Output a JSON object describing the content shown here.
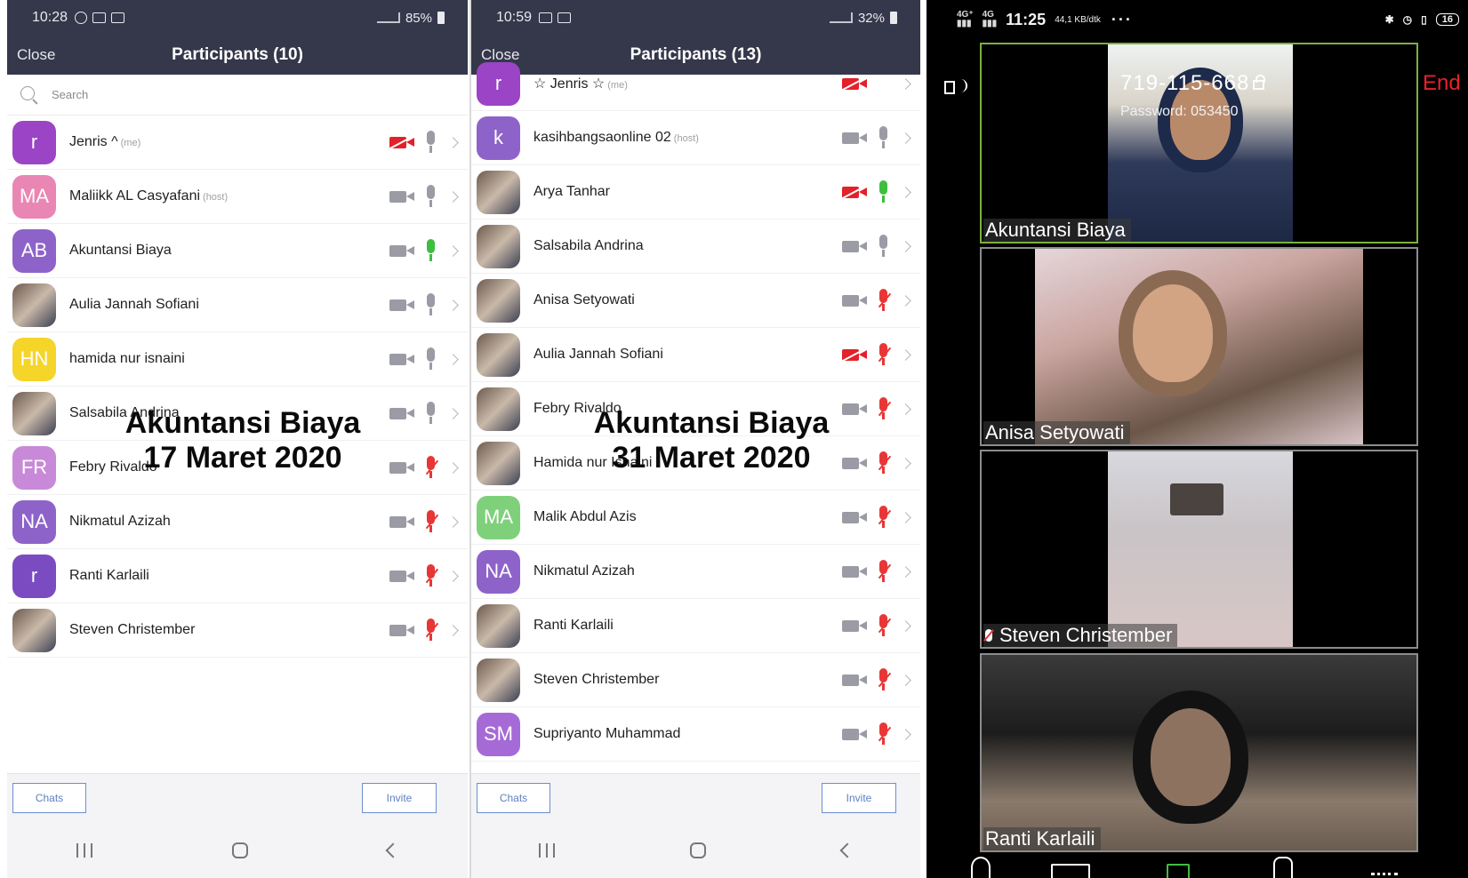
{
  "panel1": {
    "status": {
      "time": "10:28",
      "battery": "85%"
    },
    "header": {
      "close_label": "Close",
      "title": "Participants (10)"
    },
    "search": {
      "placeholder": "Search"
    },
    "participants": [
      {
        "name": "Jenris ^",
        "tag": "(me)",
        "initials": "r",
        "color": "#9b45c6",
        "video": "off",
        "mic": "idle"
      },
      {
        "name": "Maliikk AL Casyafani",
        "tag": "(host)",
        "initials": "MA",
        "color": "#e986b3",
        "video": "on",
        "mic": "idle"
      },
      {
        "name": "Akuntansi Biaya",
        "tag": "",
        "initials": "AB",
        "color": "#8e63c9",
        "video": "on",
        "mic": "on"
      },
      {
        "name": "Aulia Jannah Sofiani",
        "tag": "",
        "initials": "",
        "color": "",
        "video": "on",
        "mic": "idle"
      },
      {
        "name": "hamida nur isnaini",
        "tag": "",
        "initials": "HN",
        "color": "#f5d52a",
        "video": "on",
        "mic": "idle"
      },
      {
        "name": "Salsabila Andrina",
        "tag": "",
        "initials": "",
        "color": "",
        "video": "on",
        "mic": "idle"
      },
      {
        "name": "Febry Rivaldo",
        "tag": "",
        "initials": "FR",
        "color": "#c88ad8",
        "video": "on",
        "mic": "muted"
      },
      {
        "name": "Nikmatul Azizah",
        "tag": "",
        "initials": "NA",
        "color": "#8e63c9",
        "video": "on",
        "mic": "muted"
      },
      {
        "name": "Ranti Karlaili",
        "tag": "",
        "initials": "r",
        "color": "#7b4bc2",
        "video": "on",
        "mic": "muted"
      },
      {
        "name": "Steven Christember",
        "tag": "",
        "initials": "",
        "color": "",
        "video": "on",
        "mic": "muted"
      }
    ],
    "overlay": {
      "line1": "Akuntansi Biaya",
      "line2": "17 Maret 2020"
    },
    "footer": {
      "chats_label": "Chats",
      "invite_label": "Invite"
    }
  },
  "panel2": {
    "status": {
      "time": "10:59",
      "battery": "32%"
    },
    "header": {
      "close_label": "Close",
      "title": "Participants (13)"
    },
    "participants": [
      {
        "name": "☆ Jenris ☆",
        "tag": "(me)",
        "initials": "r",
        "color": "#9b45c6",
        "video": "off",
        "mic": "none"
      },
      {
        "name": "kasihbangsaonline 02",
        "tag": "(host)",
        "initials": "k",
        "color": "#8e63c9",
        "video": "on",
        "mic": "idle"
      },
      {
        "name": "Arya Tanhar",
        "tag": "",
        "initials": "",
        "color": "",
        "video": "off",
        "mic": "on"
      },
      {
        "name": "Salsabila Andrina",
        "tag": "",
        "initials": "",
        "color": "",
        "video": "on",
        "mic": "idle"
      },
      {
        "name": "Anisa Setyowati",
        "tag": "",
        "initials": "",
        "color": "",
        "video": "on",
        "mic": "muted"
      },
      {
        "name": "Aulia Jannah Sofiani",
        "tag": "",
        "initials": "",
        "color": "",
        "video": "off",
        "mic": "muted"
      },
      {
        "name": "Febry Rivaldo",
        "tag": "",
        "initials": "",
        "color": "",
        "video": "on",
        "mic": "muted"
      },
      {
        "name": "Hamida nur Isnaini",
        "tag": "",
        "initials": "",
        "color": "",
        "video": "on",
        "mic": "muted"
      },
      {
        "name": "Malik Abdul Azis",
        "tag": "",
        "initials": "MA",
        "color": "#7fd07a",
        "video": "on",
        "mic": "muted"
      },
      {
        "name": "Nikmatul Azizah",
        "tag": "",
        "initials": "NA",
        "color": "#8e63c9",
        "video": "on",
        "mic": "muted"
      },
      {
        "name": "Ranti Karlaili",
        "tag": "",
        "initials": "",
        "color": "",
        "video": "on",
        "mic": "muted"
      },
      {
        "name": "Steven Christember",
        "tag": "",
        "initials": "",
        "color": "",
        "video": "on",
        "mic": "muted"
      },
      {
        "name": "Supriyanto Muhammad",
        "tag": "",
        "initials": "SM",
        "color": "#a66ad6",
        "video": "on",
        "mic": "muted"
      }
    ],
    "overlay": {
      "line1": "Akuntansi Biaya",
      "line2": "31 Maret 2020"
    },
    "footer": {
      "chats_label": "Chats",
      "invite_label": "Invite"
    }
  },
  "videocall": {
    "status": {
      "time": "11:25",
      "data_rate": "44,1 KB/dtk"
    },
    "meeting_id": "719-115-668",
    "password": "Password: 053450",
    "end_label": "End",
    "tiles": [
      {
        "name": "Akuntansi Biaya",
        "muted": false,
        "active": true
      },
      {
        "name": "Anisa Setyowati",
        "muted": false,
        "active": false
      },
      {
        "name": "Steven Christember",
        "muted": true,
        "active": false
      },
      {
        "name": "Ranti Karlaili",
        "muted": false,
        "active": false
      }
    ]
  },
  "colors": {
    "header_bg": "#35374a",
    "active_speaker": "#7cb041",
    "end_red": "#e6222a",
    "muted_red": "#e83636",
    "mic_on_green": "#3fbd3f"
  }
}
